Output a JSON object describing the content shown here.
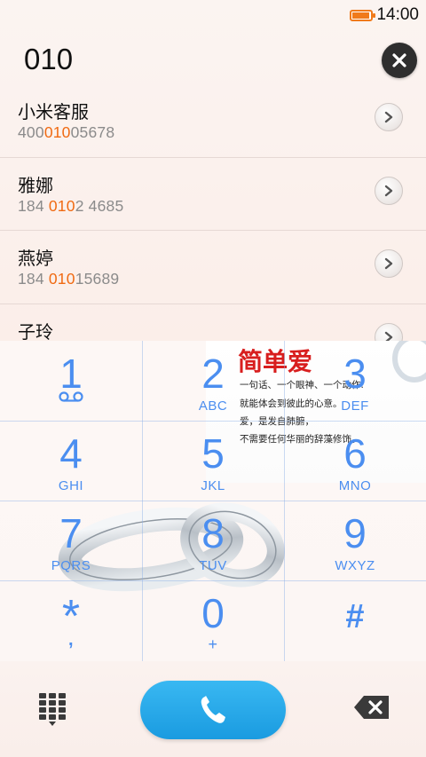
{
  "status_bar": {
    "time": "14:00",
    "battery_icon": "battery-icon",
    "battery_level": 0.9,
    "accent": "#f07a1a"
  },
  "dialer": {
    "input_value": "010",
    "clear_icon": "clear-icon"
  },
  "contacts": [
    {
      "name": "小米客服",
      "number_pre": "400",
      "number_match": "010",
      "number_post": "05678"
    },
    {
      "name": "雅娜",
      "number_pre": "184 ",
      "number_match": "010",
      "number_post": "2 4685"
    },
    {
      "name": "燕婷",
      "number_pre": "184 ",
      "number_match": "010",
      "number_post": "15689"
    },
    {
      "name": "子玲",
      "number_pre": "",
      "number_match": "",
      "number_post": ""
    }
  ],
  "keypad": {
    "keys": [
      {
        "digit": "1",
        "letters": ""
      },
      {
        "digit": "2",
        "letters": "ABC"
      },
      {
        "digit": "3",
        "letters": "DEF"
      },
      {
        "digit": "4",
        "letters": "GHI"
      },
      {
        "digit": "5",
        "letters": "JKL"
      },
      {
        "digit": "6",
        "letters": "MNO"
      },
      {
        "digit": "7",
        "letters": "PQRS"
      },
      {
        "digit": "8",
        "letters": "TUV"
      },
      {
        "digit": "9",
        "letters": "WXYZ"
      },
      {
        "digit": "*",
        "letters": ","
      },
      {
        "digit": "0",
        "letters": "+"
      },
      {
        "digit": "#",
        "letters": ""
      }
    ],
    "key_color": "#4b8ef0"
  },
  "promo": {
    "title": "简单爱",
    "lines": [
      "一句话、一个眼神、一个动作.",
      "就能体会到彼此的心意。",
      "爱，是发自肺腑，",
      "不需要任何华丽的辞藻修饰。"
    ]
  },
  "bottom_bar": {
    "dialpad_icon": "dialpad-icon",
    "call_icon": "phone-icon",
    "backspace_icon": "backspace-icon",
    "call_color": "#1fa3e6"
  },
  "colors": {
    "match_highlight": "#f06a12",
    "secondary_text": "#8b8b8b"
  }
}
